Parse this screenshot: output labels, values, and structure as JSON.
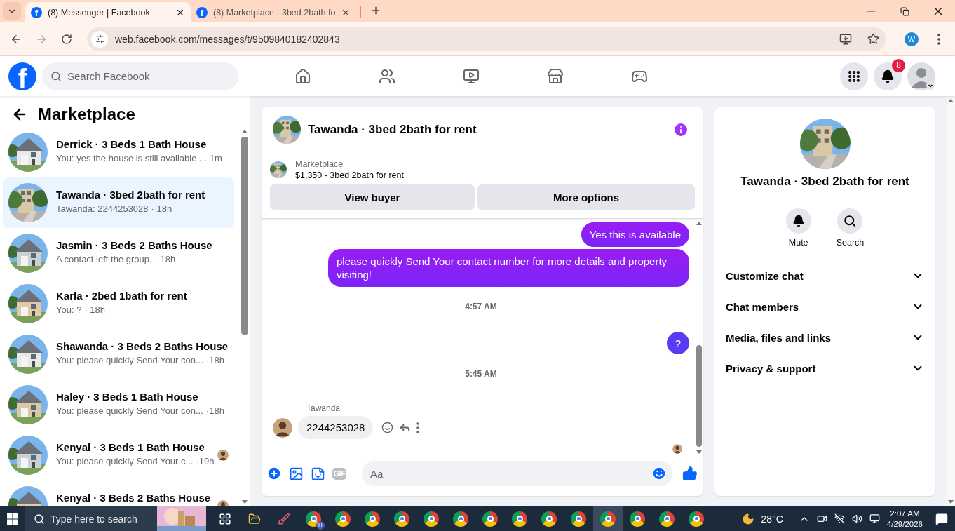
{
  "browser": {
    "tabs": [
      {
        "title": "(8) Messenger | Facebook",
        "icon_letter": "f",
        "selected": true
      },
      {
        "title": "(8) Marketplace - 3bed 2bath fo",
        "icon_letter": "f",
        "selected": false
      }
    ],
    "url": "web.facebook.com/messages/t/9509840182402843",
    "profile_initial": "W"
  },
  "header": {
    "logo": "f",
    "search_placeholder": "Search Facebook",
    "notification_count": "8"
  },
  "sidebar": {
    "title": "Marketplace",
    "conversations": [
      {
        "name": "Derrick · 3 Beds 1 Bath House",
        "preview": "You: yes the house is still available ...",
        "time": "1m",
        "selected": false,
        "seen": false
      },
      {
        "name": "Tawanda · 3bed 2bath for rent",
        "preview": "Tawanda: 2244253028",
        "time": "· 18h",
        "selected": true,
        "seen": false
      },
      {
        "name": "Jasmin · 3 Beds 2 Baths House",
        "preview": "A contact left the group.",
        "time": "· 18h",
        "selected": false,
        "seen": false
      },
      {
        "name": "Karla · 2bed 1bath for rent",
        "preview": "You: ?",
        "time": "· 18h",
        "selected": false,
        "seen": false
      },
      {
        "name": "Shawanda · 3 Beds 2 Baths House",
        "preview": "You: please quickly Send Your con...",
        "time": "·18h",
        "selected": false,
        "seen": false
      },
      {
        "name": "Haley · 3 Beds 1 Bath House",
        "preview": "You: please quickly Send Your con...",
        "time": "·18h",
        "selected": false,
        "seen": false
      },
      {
        "name": "Kenyal · 3 Beds 1 Bath House",
        "preview": "You: please quickly Send Your c...",
        "time": "·19h",
        "selected": false,
        "seen": true
      },
      {
        "name": "Kenyal · 3 Beds 2 Baths House",
        "selected": false,
        "seen": true
      }
    ]
  },
  "chat": {
    "title": "Tawanda · 3bed 2bath for rent",
    "listing": {
      "label": "Marketplace",
      "title": "$1,350 - 3bed 2bath for rent"
    },
    "buttons": [
      "View buyer",
      "More options"
    ],
    "messages": [
      {
        "kind": "outgoing",
        "text": "Yes this is available"
      },
      {
        "kind": "outgoing",
        "text": "please quickly Send Your contact number for more details and property visiting!"
      },
      {
        "kind": "timestamp",
        "text": "4:57 AM"
      },
      {
        "kind": "outgoing",
        "text": "?"
      },
      {
        "kind": "timestamp",
        "text": "5:45 AM"
      },
      {
        "kind": "incoming",
        "sender": "Tawanda",
        "text": "2244253028"
      },
      {
        "kind": "receipt"
      }
    ],
    "composer": {
      "gif_label": "GIF",
      "placeholder": "Aa"
    }
  },
  "details": {
    "name": "Tawanda · 3bed 2bath for rent",
    "actions": [
      {
        "kind": "mute",
        "label": "Mute"
      },
      {
        "kind": "search",
        "label": "Search"
      }
    ],
    "sections": [
      {
        "label": "Customize chat",
        "expanded": false
      },
      {
        "label": "Chat members",
        "expanded": false
      },
      {
        "label": "Media, files and links",
        "expanded": false
      },
      {
        "label": "Privacy & support",
        "expanded": false
      }
    ]
  },
  "taskbar": {
    "search_placeholder": "Type here to search",
    "apps": [
      {
        "kind": "taskview"
      },
      {
        "kind": "files"
      },
      {
        "kind": "paint"
      },
      {
        "kind": "chrome",
        "badge": "H",
        "active": false
      },
      {
        "kind": "chrome",
        "active": false
      },
      {
        "kind": "chrome",
        "active": false
      },
      {
        "kind": "chrome",
        "active": false
      },
      {
        "kind": "chrome",
        "active": false
      },
      {
        "kind": "chrome",
        "active": false
      },
      {
        "kind": "chrome",
        "active": false
      },
      {
        "kind": "chrome",
        "active": false
      },
      {
        "kind": "chrome",
        "active": false
      },
      {
        "kind": "chrome",
        "active": false
      },
      {
        "kind": "chrome",
        "active": true
      },
      {
        "kind": "chrome",
        "active": false
      },
      {
        "kind": "chrome",
        "active": false
      },
      {
        "kind": "chrome",
        "active": false
      }
    ],
    "temperature": "28°C",
    "time": "2:07 AM",
    "date": "4/29/2026"
  }
}
